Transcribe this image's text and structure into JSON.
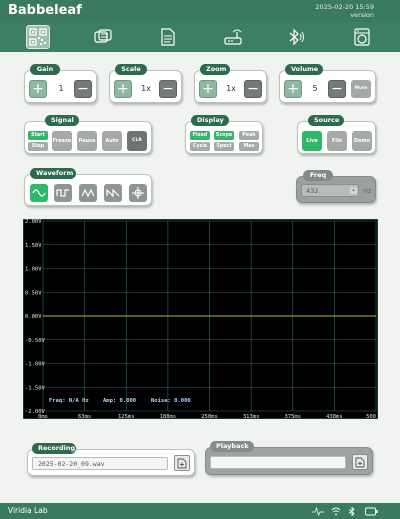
{
  "header": {
    "title": "Babbeleaf",
    "datetime": "2025-02-20 15:59",
    "version": "version"
  },
  "toolbar": {
    "items": [
      "qr-code-icon",
      "copy-docs-icon",
      "document-icon",
      "router-icon",
      "bluetooth-signal-icon",
      "washing-machine-icon"
    ]
  },
  "gain": {
    "title": "Gain",
    "value": "1",
    "plus": "+",
    "minus": "−"
  },
  "scale": {
    "title": "Scale",
    "value": "1x",
    "plus": "+",
    "minus": "−"
  },
  "zoom": {
    "title": "Zoom",
    "value": "1x",
    "plus": "+",
    "minus": "−"
  },
  "volume": {
    "title": "Volume",
    "value": "5",
    "plus": "+",
    "minus": "−",
    "mute": "Mute"
  },
  "signal": {
    "title": "Signal",
    "start": "Start",
    "stop": "Stop",
    "freeze": "Freeze",
    "pause": "Pause",
    "auto": "Auto",
    "clr": "CLR"
  },
  "display": {
    "title": "Display",
    "fixed": "Fixed",
    "cycle": "Cycle",
    "scope": "Scope",
    "spect": "Spect",
    "peak": "Peak",
    "max": "Max"
  },
  "source": {
    "title": "Source",
    "live": "Live",
    "file": "File",
    "demo": "Demo"
  },
  "waveform": {
    "title": "Waveform",
    "items": [
      "sine-wave-icon",
      "square-wave-icon",
      "triangle-wave-icon",
      "sawtooth-wave-icon",
      "noise-icon"
    ]
  },
  "freq": {
    "title": "Freq",
    "value": "432",
    "unit": "Hz"
  },
  "chart_data": {
    "type": "line",
    "title": "",
    "xlabel": "",
    "ylabel": "",
    "x_ticks": [
      "0ms",
      "63ms",
      "125ms",
      "188ms",
      "250ms",
      "313ms",
      "375ms",
      "438ms",
      "500"
    ],
    "y_ticks": [
      "2.00V",
      "1.50V",
      "1.00V",
      "0.50V",
      "0.00V",
      "-0.50V",
      "-1.00V",
      "-1.50V",
      "-2.00V"
    ],
    "xlim": [
      0,
      500
    ],
    "ylim": [
      -2,
      2
    ],
    "grid": true,
    "series": [
      {
        "values_x": [
          0,
          500
        ],
        "values_y": [
          0,
          0
        ],
        "color": "#b8b23a"
      }
    ],
    "status": {
      "freq": "Freq: N/A Hz",
      "amp": "Amp: 0.000",
      "noise": "Noise: 0.000"
    }
  },
  "recording": {
    "title": "Recording",
    "filename": "2025-02-20_09.wav"
  },
  "playback": {
    "title": "Playback",
    "filename": ""
  },
  "footer": {
    "label": "Viridia Lab",
    "icons": [
      "heartbeat-icon",
      "wifi-icon",
      "bluetooth-icon",
      "battery-icon"
    ]
  },
  "colors": {
    "header": "#3a7a5e",
    "accent": "#38b46b",
    "chart_bg": "#000000",
    "grid": "#2f6e6a"
  }
}
